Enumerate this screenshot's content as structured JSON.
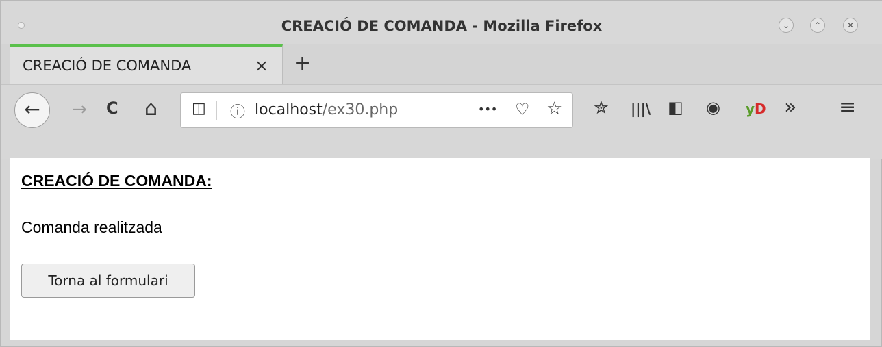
{
  "window": {
    "title": "CREACIÓ DE COMANDA - Mozilla Firefox",
    "minimize_glyph": "⌄",
    "maximize_glyph": "⌃",
    "close_glyph": "✕"
  },
  "tabs": [
    {
      "label": "CREACIÓ DE COMANDA",
      "close_glyph": "×"
    }
  ],
  "new_tab_glyph": "+",
  "nav": {
    "back_glyph": "←",
    "forward_glyph": "→",
    "reload_glyph": "C",
    "home_glyph": "⌂"
  },
  "url": {
    "shield_glyph": "◫",
    "info_glyph": "ⓘ",
    "host": "localhost",
    "path": "/ex30.php",
    "more_glyph": "•••",
    "pocket_glyph": "♡",
    "bookmark_glyph": "☆"
  },
  "toolbar": {
    "bookmarks_glyph": "✮",
    "library_glyph": "𝍪",
    "sidebar_glyph": "◧",
    "account_glyph": "◉",
    "yd_prefix": "y",
    "yd_suffix": "D",
    "overflow_glyph": "»",
    "menu_glyph": "≡"
  },
  "page": {
    "heading": "CREACIÓ DE COMANDA:",
    "message": "Comanda realitzada",
    "button_label": "Torna al formulari"
  }
}
